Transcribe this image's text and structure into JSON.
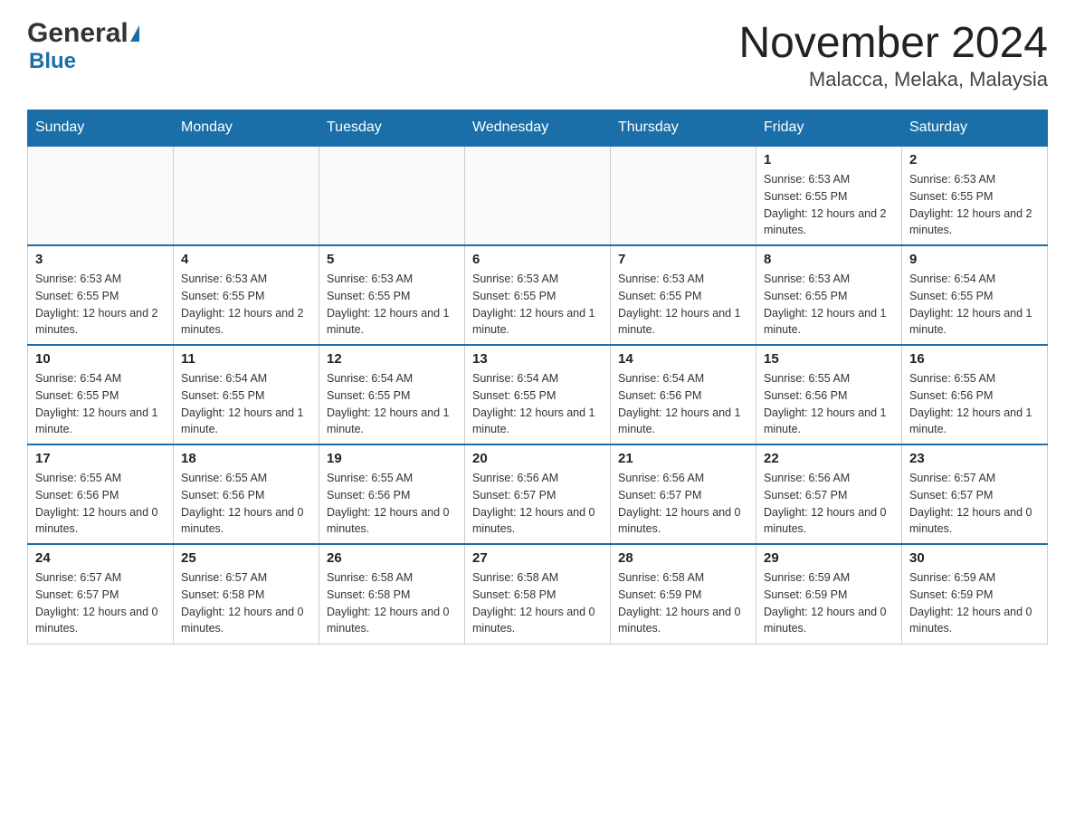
{
  "logo": {
    "general": "General",
    "blue": "Blue"
  },
  "title": "November 2024",
  "subtitle": "Malacca, Melaka, Malaysia",
  "days_of_week": [
    "Sunday",
    "Monday",
    "Tuesday",
    "Wednesday",
    "Thursday",
    "Friday",
    "Saturday"
  ],
  "weeks": [
    [
      {
        "day": "",
        "info": ""
      },
      {
        "day": "",
        "info": ""
      },
      {
        "day": "",
        "info": ""
      },
      {
        "day": "",
        "info": ""
      },
      {
        "day": "",
        "info": ""
      },
      {
        "day": "1",
        "info": "Sunrise: 6:53 AM\nSunset: 6:55 PM\nDaylight: 12 hours and 2 minutes."
      },
      {
        "day": "2",
        "info": "Sunrise: 6:53 AM\nSunset: 6:55 PM\nDaylight: 12 hours and 2 minutes."
      }
    ],
    [
      {
        "day": "3",
        "info": "Sunrise: 6:53 AM\nSunset: 6:55 PM\nDaylight: 12 hours and 2 minutes."
      },
      {
        "day": "4",
        "info": "Sunrise: 6:53 AM\nSunset: 6:55 PM\nDaylight: 12 hours and 2 minutes."
      },
      {
        "day": "5",
        "info": "Sunrise: 6:53 AM\nSunset: 6:55 PM\nDaylight: 12 hours and 1 minute."
      },
      {
        "day": "6",
        "info": "Sunrise: 6:53 AM\nSunset: 6:55 PM\nDaylight: 12 hours and 1 minute."
      },
      {
        "day": "7",
        "info": "Sunrise: 6:53 AM\nSunset: 6:55 PM\nDaylight: 12 hours and 1 minute."
      },
      {
        "day": "8",
        "info": "Sunrise: 6:53 AM\nSunset: 6:55 PM\nDaylight: 12 hours and 1 minute."
      },
      {
        "day": "9",
        "info": "Sunrise: 6:54 AM\nSunset: 6:55 PM\nDaylight: 12 hours and 1 minute."
      }
    ],
    [
      {
        "day": "10",
        "info": "Sunrise: 6:54 AM\nSunset: 6:55 PM\nDaylight: 12 hours and 1 minute."
      },
      {
        "day": "11",
        "info": "Sunrise: 6:54 AM\nSunset: 6:55 PM\nDaylight: 12 hours and 1 minute."
      },
      {
        "day": "12",
        "info": "Sunrise: 6:54 AM\nSunset: 6:55 PM\nDaylight: 12 hours and 1 minute."
      },
      {
        "day": "13",
        "info": "Sunrise: 6:54 AM\nSunset: 6:55 PM\nDaylight: 12 hours and 1 minute."
      },
      {
        "day": "14",
        "info": "Sunrise: 6:54 AM\nSunset: 6:56 PM\nDaylight: 12 hours and 1 minute."
      },
      {
        "day": "15",
        "info": "Sunrise: 6:55 AM\nSunset: 6:56 PM\nDaylight: 12 hours and 1 minute."
      },
      {
        "day": "16",
        "info": "Sunrise: 6:55 AM\nSunset: 6:56 PM\nDaylight: 12 hours and 1 minute."
      }
    ],
    [
      {
        "day": "17",
        "info": "Sunrise: 6:55 AM\nSunset: 6:56 PM\nDaylight: 12 hours and 0 minutes."
      },
      {
        "day": "18",
        "info": "Sunrise: 6:55 AM\nSunset: 6:56 PM\nDaylight: 12 hours and 0 minutes."
      },
      {
        "day": "19",
        "info": "Sunrise: 6:55 AM\nSunset: 6:56 PM\nDaylight: 12 hours and 0 minutes."
      },
      {
        "day": "20",
        "info": "Sunrise: 6:56 AM\nSunset: 6:57 PM\nDaylight: 12 hours and 0 minutes."
      },
      {
        "day": "21",
        "info": "Sunrise: 6:56 AM\nSunset: 6:57 PM\nDaylight: 12 hours and 0 minutes."
      },
      {
        "day": "22",
        "info": "Sunrise: 6:56 AM\nSunset: 6:57 PM\nDaylight: 12 hours and 0 minutes."
      },
      {
        "day": "23",
        "info": "Sunrise: 6:57 AM\nSunset: 6:57 PM\nDaylight: 12 hours and 0 minutes."
      }
    ],
    [
      {
        "day": "24",
        "info": "Sunrise: 6:57 AM\nSunset: 6:57 PM\nDaylight: 12 hours and 0 minutes."
      },
      {
        "day": "25",
        "info": "Sunrise: 6:57 AM\nSunset: 6:58 PM\nDaylight: 12 hours and 0 minutes."
      },
      {
        "day": "26",
        "info": "Sunrise: 6:58 AM\nSunset: 6:58 PM\nDaylight: 12 hours and 0 minutes."
      },
      {
        "day": "27",
        "info": "Sunrise: 6:58 AM\nSunset: 6:58 PM\nDaylight: 12 hours and 0 minutes."
      },
      {
        "day": "28",
        "info": "Sunrise: 6:58 AM\nSunset: 6:59 PM\nDaylight: 12 hours and 0 minutes."
      },
      {
        "day": "29",
        "info": "Sunrise: 6:59 AM\nSunset: 6:59 PM\nDaylight: 12 hours and 0 minutes."
      },
      {
        "day": "30",
        "info": "Sunrise: 6:59 AM\nSunset: 6:59 PM\nDaylight: 12 hours and 0 minutes."
      }
    ]
  ]
}
